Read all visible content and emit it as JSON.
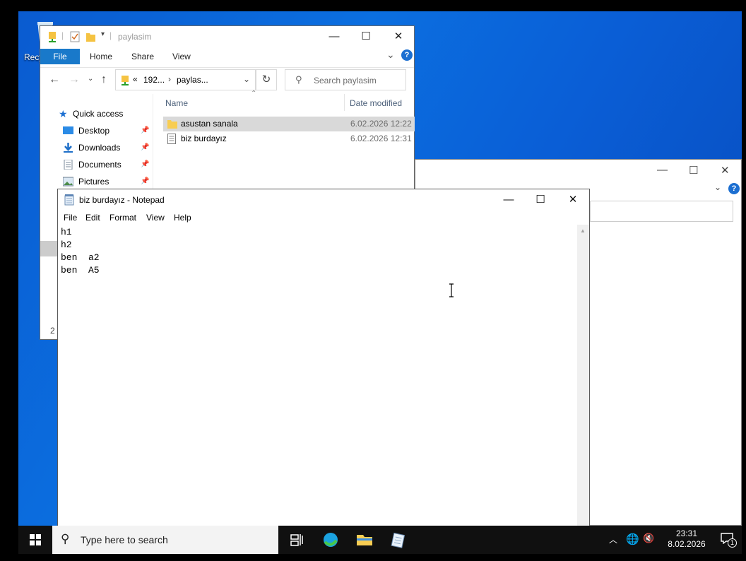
{
  "desktop": {
    "recycle_bin_label": "Recy"
  },
  "explorer": {
    "title": "paylasim",
    "ribbon_tabs": [
      "File",
      "Home",
      "Share",
      "View"
    ],
    "address": {
      "prefix": "«",
      "segment1": "192...",
      "separator": "›",
      "segment2": "paylas..."
    },
    "search_placeholder": "Search paylasim",
    "nav_pane": {
      "quick_access": "Quick access",
      "items": [
        "Desktop",
        "Downloads",
        "Documents",
        "Pictures"
      ]
    },
    "columns": {
      "name": "Name",
      "date_modified": "Date modified"
    },
    "files": [
      {
        "name": "asustan sanala",
        "date": "6.02.2026 12:22",
        "type": "folder",
        "selected": true
      },
      {
        "name": "biz burdayız",
        "date": "6.02.2026 12:31",
        "type": "text",
        "selected": false
      }
    ],
    "status_count": "2"
  },
  "notepad": {
    "title": "biz burdayız - Notepad",
    "menu": [
      "File",
      "Edit",
      "Format",
      "View",
      "Help"
    ],
    "lines": [
      "h1",
      "h2",
      "ben  a2",
      "ben  A5"
    ]
  },
  "taskbar": {
    "search_placeholder": "Type here to search",
    "time": "23:31",
    "date": "8.02.2026",
    "notification_count": "1"
  },
  "colors": {
    "accent": "#1979ca",
    "desktop_blue": "#0b6fe0",
    "taskbar": "#101010",
    "selection": "#cce8ff"
  }
}
